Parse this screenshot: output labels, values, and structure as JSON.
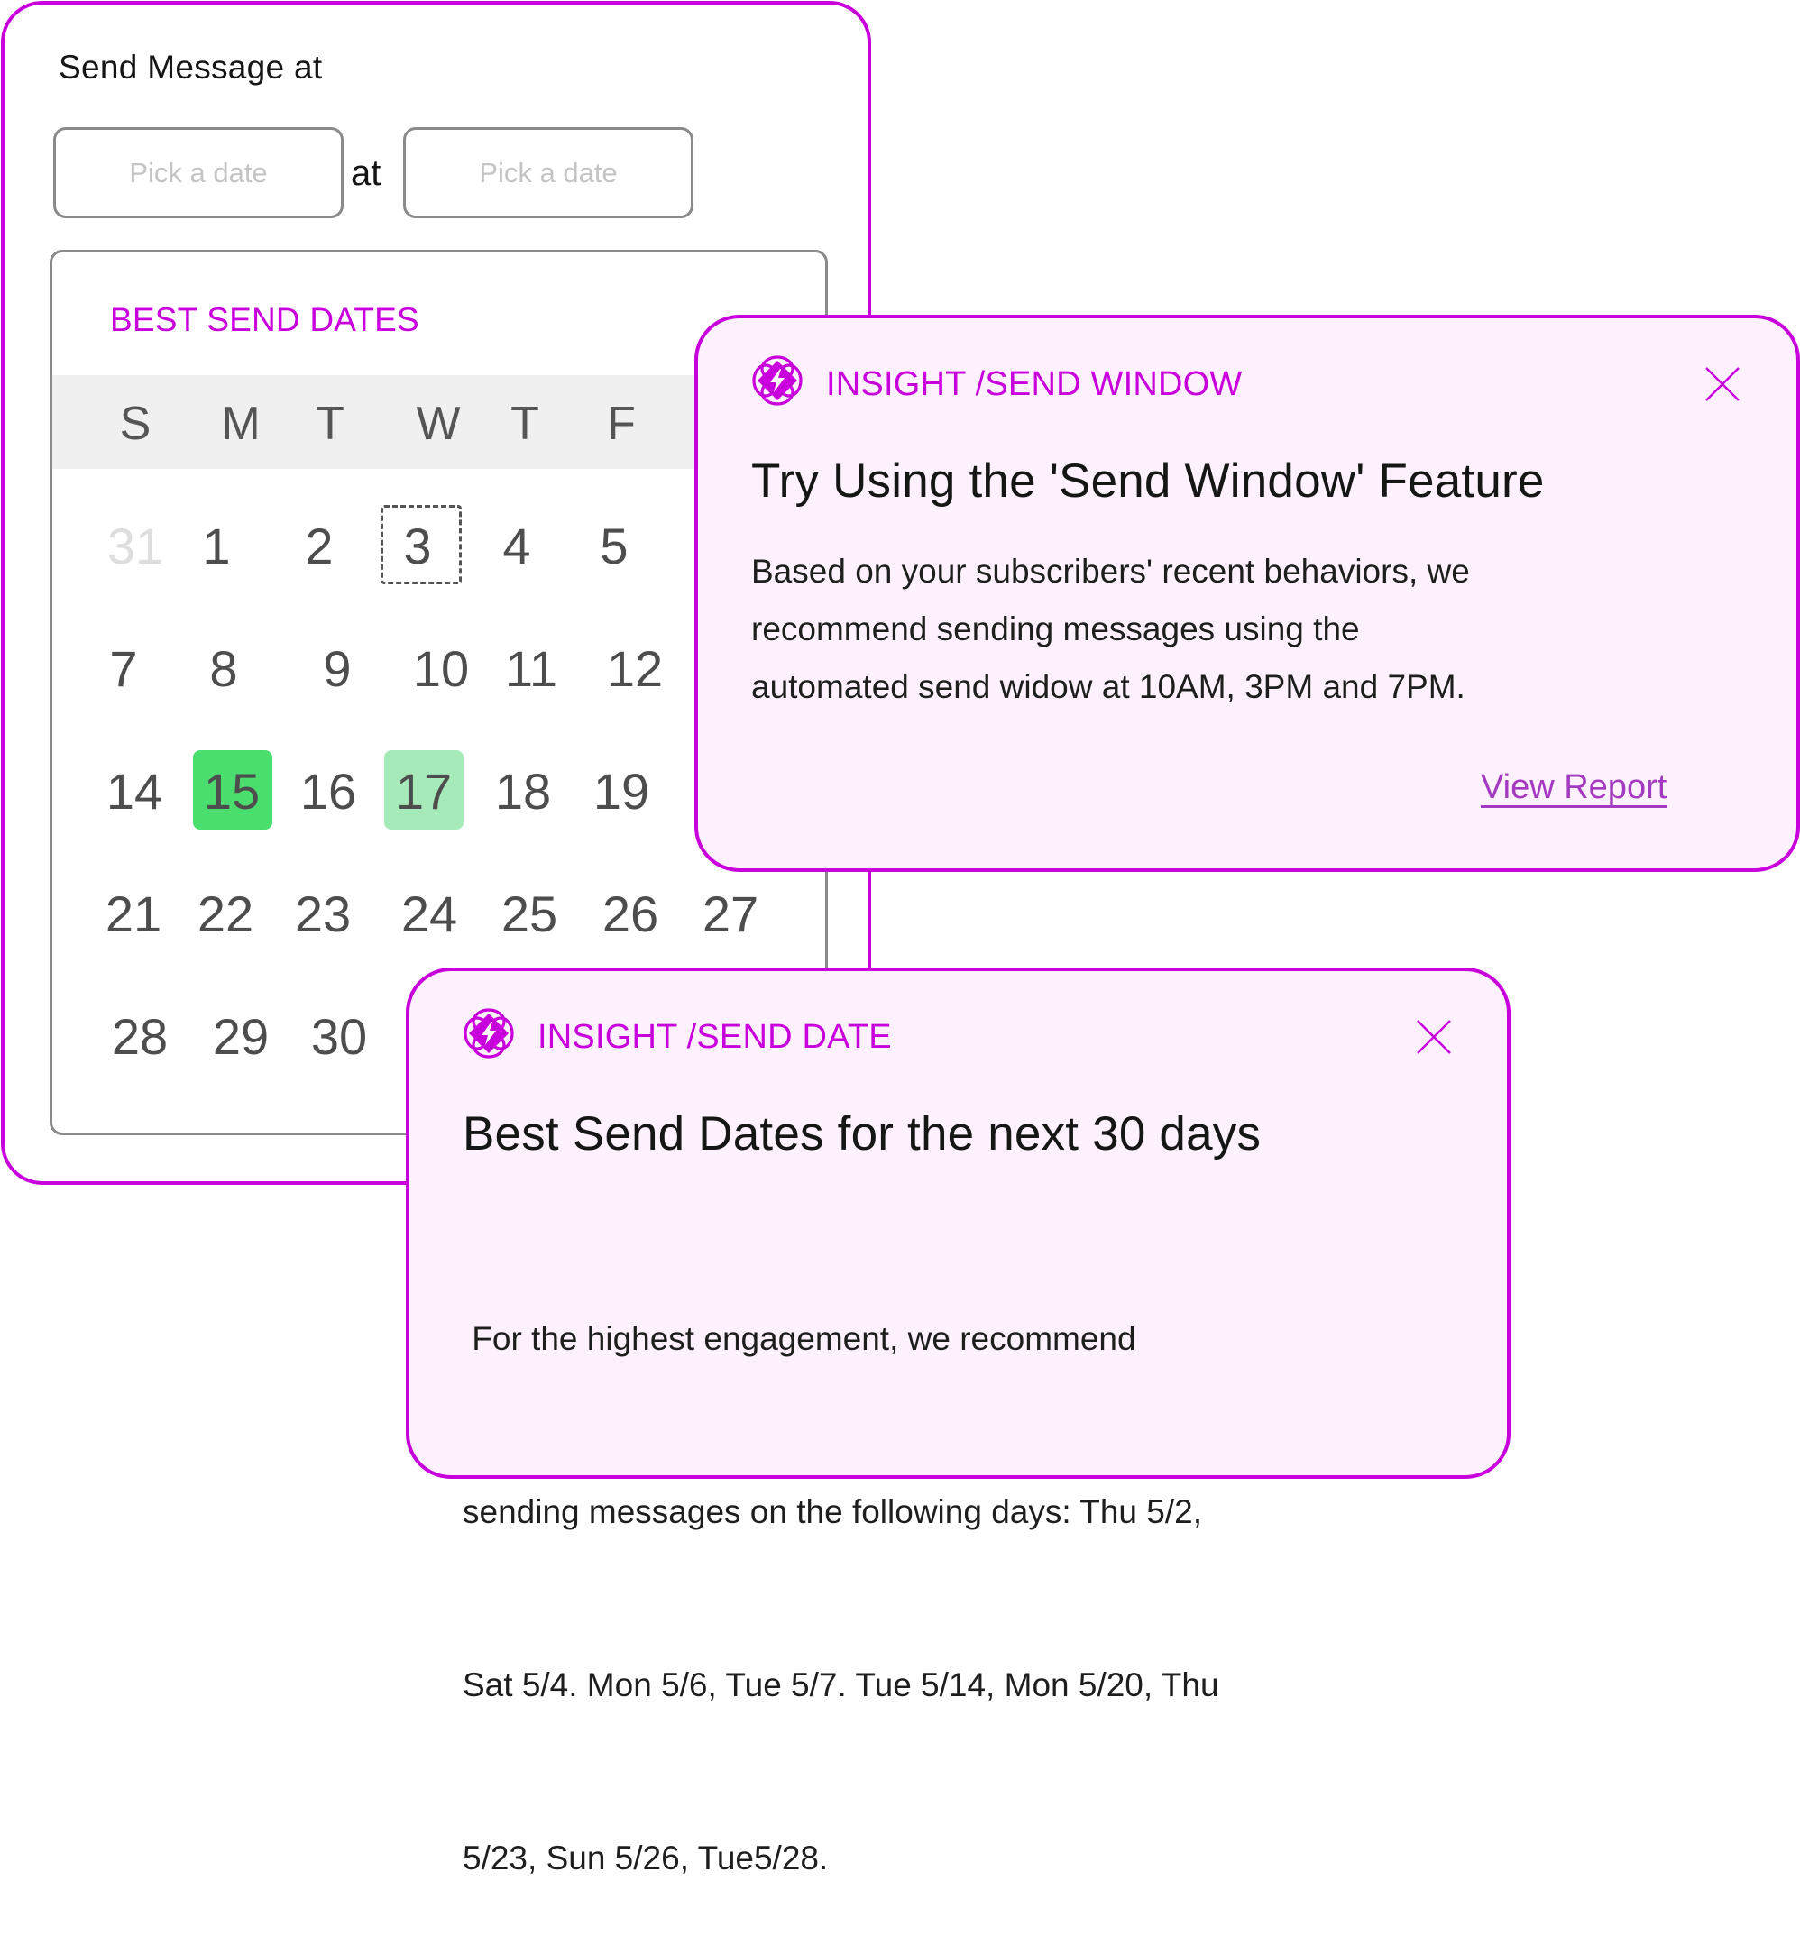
{
  "scheduler": {
    "title": "Send Message at",
    "date_input_placeholder": "Pick a date",
    "time_input_placeholder": "Pick a date",
    "at_label": "at"
  },
  "calendar": {
    "title": "BEST SEND DATES",
    "weekdays": [
      "S",
      "M",
      "T",
      "W",
      "T",
      "F"
    ],
    "rows": [
      [
        "31",
        "1",
        "2",
        "3",
        "4",
        "5"
      ],
      [
        "7",
        "8",
        "9",
        "10",
        "11",
        "12"
      ],
      [
        "14",
        "15",
        "16",
        "17",
        "18",
        "19"
      ],
      [
        "21",
        "22",
        "23",
        "24",
        "25",
        "26",
        "27"
      ],
      [
        "28",
        "29",
        "30"
      ]
    ],
    "muted_days": [
      "31"
    ],
    "today": "3",
    "best_day": "15",
    "good_day": "17",
    "colors": {
      "best": "#4ade6e",
      "good": "#a7eab9",
      "accent": "#c800dc"
    }
  },
  "insight_send_window": {
    "icon": "insight-flower-bolt-icon",
    "tag_keyword": "INSIGHT",
    "tag_topic": "/SEND WINDOW",
    "title": "Try Using the 'Send Window' Feature",
    "body_lines": [
      "Based on your subscribers' recent behaviors, we",
      "recommend sending messages using the",
      "automated send widow at 10AM, 3PM and 7PM."
    ],
    "link_label": "View Report",
    "close_icon": "close-icon"
  },
  "insight_send_date": {
    "icon": "insight-flower-bolt-icon",
    "tag_keyword": "INSIGHT",
    "tag_topic": "/SEND DATE",
    "title": "Best Send Dates for the next 30 days",
    "body_lines": [
      " For the highest engagement, we recommend",
      "sending messages on the following days: Thu 5/2,",
      "Sat 5/4. Mon 5/6, Tue 5/7. Tue 5/14, Mon 5/20, Thu",
      "5/23, Sun 5/26, Tue5/28."
    ],
    "close_icon": "close-icon"
  }
}
